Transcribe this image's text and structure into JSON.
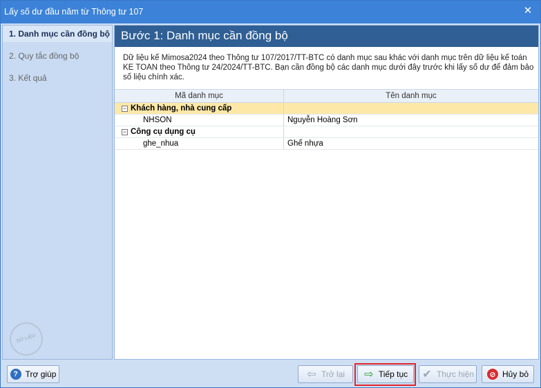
{
  "window": {
    "title": "Lấy số dư đầu năm từ Thông tư 107",
    "close_glyph": "✕"
  },
  "sidebar": {
    "steps": [
      {
        "label": "1. Danh mục cần đồng bộ"
      },
      {
        "label": "2. Quy tắc đồng bộ"
      },
      {
        "label": "3. Kết quả"
      }
    ],
    "stamp_text": "DỮ LIỆU MẪU"
  },
  "main": {
    "step_title": "Bước 1: Danh mục cần đồng bộ",
    "description": "Dữ liệu kế Mimosa2024 theo Thông tư 107/2017/TT-BTC có danh mục sau khác với danh mục trên dữ liệu kế toán KE TOAN theo Thông tư 24/2024/TT-BTC. Bạn cần đồng bộ các danh mục dưới đây trước khi lấy số dư để đảm bảo số liệu chính xác.",
    "table": {
      "columns": [
        "Mã danh mục",
        "Tên danh mục"
      ],
      "groups": [
        {
          "name": "Khách hàng, nhà cung cấp",
          "toggle": "−",
          "rows": [
            {
              "code": "NHSON",
              "name": "Nguyễn Hoàng Sơn"
            }
          ]
        },
        {
          "name": "Công cụ dụng cụ",
          "toggle": "−",
          "rows": [
            {
              "code": "ghe_nhua",
              "name": "Ghế nhựa"
            }
          ]
        }
      ]
    }
  },
  "footer": {
    "help": "Trợ giúp",
    "back": "Trở lại",
    "next": "Tiếp tục",
    "execute": "Thực hiện",
    "cancel": "Hủy bỏ",
    "icons": {
      "help": "?",
      "back": "⇦",
      "next": "⇨",
      "execute": "✔",
      "cancel": "⊘"
    }
  },
  "colors": {
    "title_bar": "#3b82d8",
    "step_header": "#2f5f94",
    "selected_row": "#fde8a8",
    "highlight": "#e0242a"
  }
}
